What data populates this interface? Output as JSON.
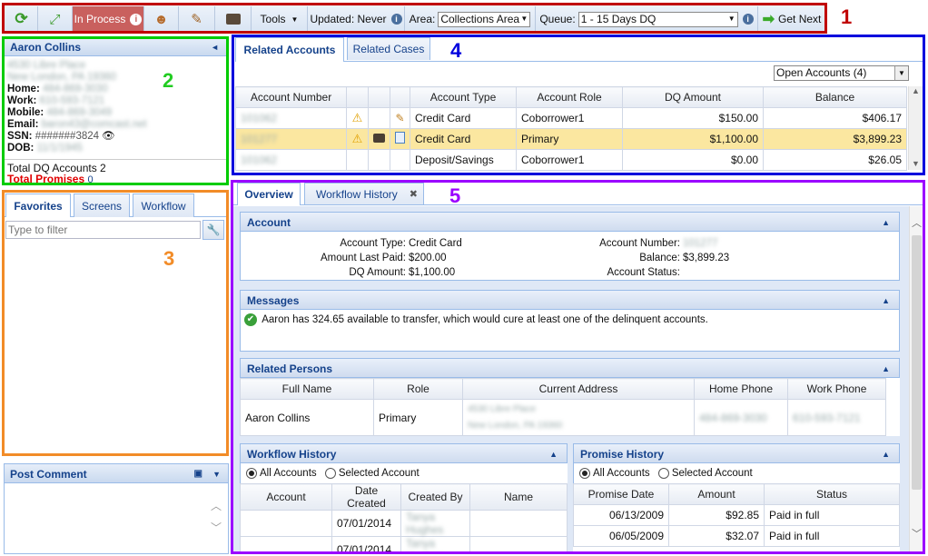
{
  "toolbar": {
    "in_process_label": "In Process",
    "tools_label": "Tools",
    "updated_label": "Updated: Never",
    "area_label": "Area:",
    "area_value": "Collections Area",
    "queue_label": "Queue:",
    "queue_value": "1 - 15 Days DQ",
    "get_next_label": "Get Next"
  },
  "contact": {
    "name": "Aaron Collins",
    "address1": "4530 Libre Place",
    "address2": "New London, PA 19360",
    "home_label": "Home:",
    "home_value": "484-869-3030",
    "work_label": "Work:",
    "work_value": "610-593-7121",
    "mobile_label": "Mobile:",
    "mobile_value": "484-869-3049",
    "email_label": "Email:",
    "email_value": "baron43@comcast.net",
    "ssn_label": "SSN:",
    "ssn_value": "#######3824",
    "dob_label": "DOB:",
    "dob_value": "11/1/1945",
    "total_dq_label": "Total DQ Accounts 2",
    "total_promises_label": "Total Promises",
    "total_promises_count": "0"
  },
  "left_tabs": [
    "Favorites",
    "Screens",
    "Workflow"
  ],
  "filter_placeholder": "Type to filter",
  "post_comment_title": "Post Comment",
  "top_tabs": [
    "Related Accounts",
    "Related Cases"
  ],
  "open_accounts_select": "Open Accounts (4)",
  "accounts_table": {
    "headers": [
      "Account Number",
      "",
      "",
      "",
      "Account Type",
      "Account Role",
      "DQ Amount",
      "Balance"
    ],
    "rows": [
      {
        "number": "101062",
        "type": "Credit Card",
        "role": "Coborrower1",
        "dq": "$150.00",
        "balance": "$406.17"
      },
      {
        "number": "101277",
        "type": "Credit Card",
        "role": "Primary",
        "dq": "$1,100.00",
        "balance": "$3,899.23"
      },
      {
        "number": "101062",
        "type": "Deposit/Savings",
        "role": "Coborrower1",
        "dq": "$0.00",
        "balance": "$26.05"
      }
    ]
  },
  "bottom_tabs": [
    "Overview",
    "Workflow History"
  ],
  "account_section": {
    "title": "Account",
    "type_label": "Account Type:",
    "type_value": "Credit Card",
    "last_paid_label": "Amount Last Paid:",
    "last_paid_value": "$200.00",
    "dq_label": "DQ Amount:",
    "dq_value": "$1,100.00",
    "number_label": "Account Number:",
    "number_value": "101277",
    "balance_label": "Balance:",
    "balance_value": "$3,899.23",
    "status_label": "Account Status:"
  },
  "messages_section": {
    "title": "Messages",
    "text": "Aaron has 324.65 available to transfer, which would cure at least one of the delinquent accounts."
  },
  "persons_section": {
    "title": "Related Persons",
    "headers": [
      "Full Name",
      "Role",
      "Current Address",
      "Home Phone",
      "Work Phone"
    ],
    "row": {
      "name": "Aaron Collins",
      "role": "Primary",
      "addr1": "4530 Libre Place",
      "addr2": "New London, PA 19360",
      "home": "484-869-3030",
      "work": "610-593-7121"
    }
  },
  "workflow_section": {
    "title": "Workflow History",
    "radio_all": "All Accounts",
    "radio_selected": "Selected Account",
    "headers": [
      "Account",
      "Date Created",
      "Created By",
      "Name"
    ],
    "rows": [
      {
        "date": "07/01/2014",
        "by": "Tanya Hughes"
      },
      {
        "date": "07/01/2014",
        "by": "Tanya Hughes"
      }
    ]
  },
  "promise_section": {
    "title": "Promise History",
    "radio_all": "All Accounts",
    "radio_selected": "Selected Account",
    "headers": [
      "Promise Date",
      "Amount",
      "Status"
    ],
    "rows": [
      {
        "date": "06/13/2009",
        "amount": "$92.85",
        "status": "Paid in full"
      },
      {
        "date": "06/05/2009",
        "amount": "$32.07",
        "status": "Paid in full"
      }
    ]
  },
  "annotations": [
    "1",
    "2",
    "3",
    "4",
    "5"
  ],
  "colors": {
    "box1": "#c00000",
    "box2": "#00cc00",
    "box3": "#f28c28",
    "box4": "#0000dd",
    "box5": "#9b00ff",
    "accent": "#15428b"
  }
}
